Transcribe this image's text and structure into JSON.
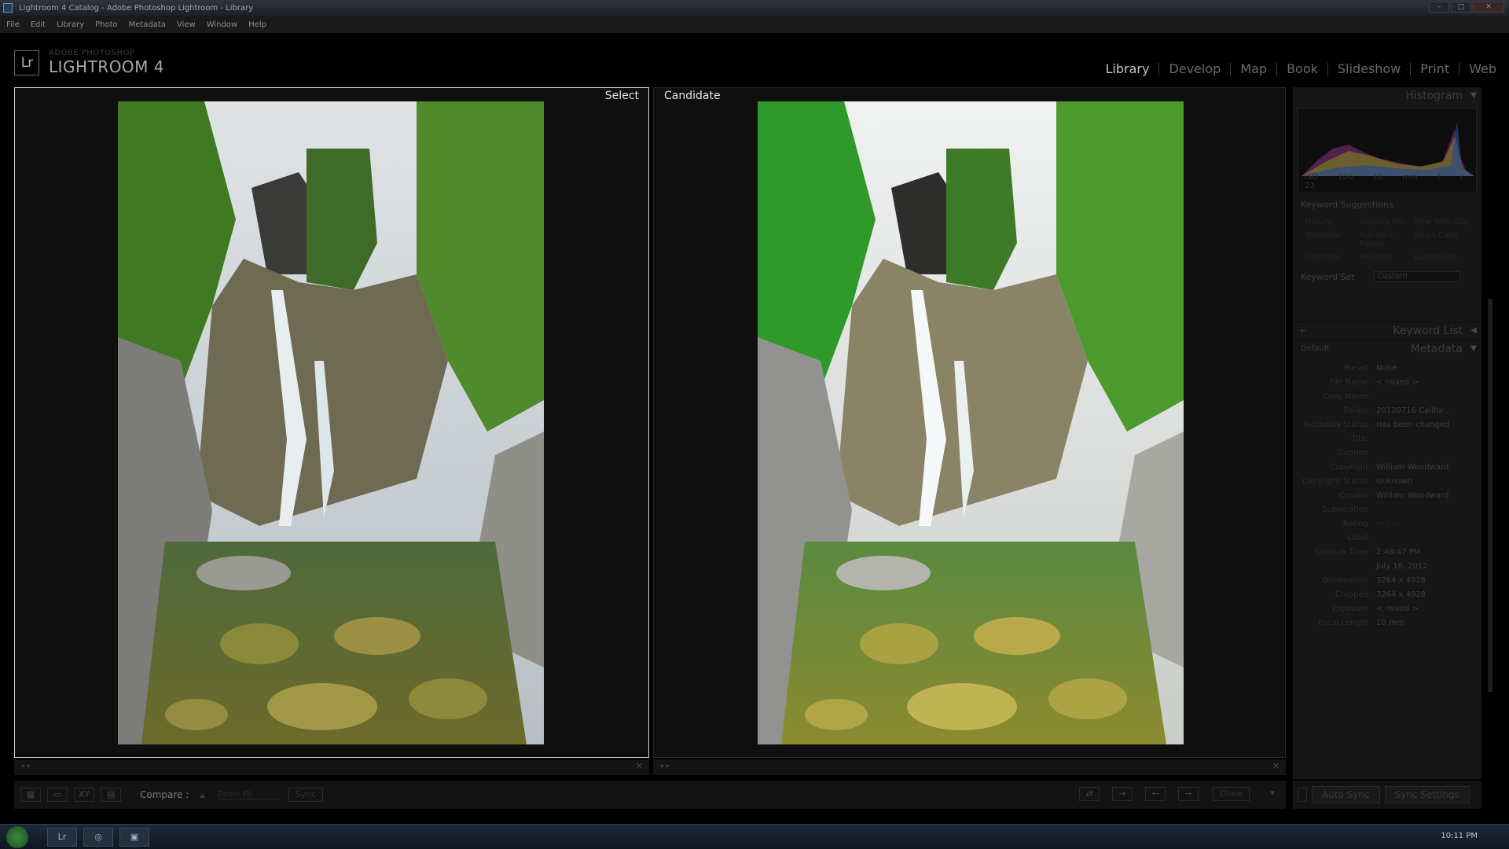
{
  "window": {
    "title": "Lightroom 4 Catalog - Adobe Photoshop Lightroom - Library",
    "buttons": [
      "–",
      "□",
      "✕"
    ]
  },
  "menu": [
    "File",
    "Edit",
    "Library",
    "Photo",
    "Metadata",
    "View",
    "Window",
    "Help"
  ],
  "identity": {
    "logo": "Lr",
    "sub": "ADOBE PHOTOSHOP",
    "main": "LIGHTROOM 4"
  },
  "modules": [
    "Library",
    "Develop",
    "Map",
    "Book",
    "Slideshow",
    "Print",
    "Web"
  ],
  "compare": {
    "select_label": "Select",
    "candidate_label": "Candidate"
  },
  "right_panel": {
    "histogram_title": "Histogram",
    "histogram_info": "ISO 100 10 mm f / 22",
    "keyword_suggestions_title": "Keyword Suggestions",
    "suggestions": [
      "Nature",
      "Arizona Bri...",
      "New York City",
      "Yosemite",
      "National Forest",
      "Kings Cany...",
      "Colorado",
      "Houston",
      "Landscape"
    ],
    "keyword_set_label": "Keyword Set",
    "keyword_set_value": "Custom",
    "keyword_list_title": "Keyword List",
    "metadata_title": "Metadata",
    "metadata_preset_default": "Default",
    "metadata": [
      {
        "k": "Preset",
        "v": "None"
      },
      {
        "k": "File Name",
        "v": "< mixed >"
      },
      {
        "k": "Copy Name",
        "v": ""
      },
      {
        "k": "Folder",
        "v": "20120716 Califor..."
      },
      {
        "k": "Metadata Status",
        "v": "Has been changed"
      },
      {
        "k": "Title",
        "v": ""
      },
      {
        "k": "Caption",
        "v": ""
      },
      {
        "k": "Copyright",
        "v": "William Woodward"
      },
      {
        "k": "Copyright Status",
        "v": "Unknown"
      },
      {
        "k": "Creator",
        "v": "William Woodward"
      },
      {
        "k": "Sublocation",
        "v": ""
      },
      {
        "k": "Rating",
        "v": "· · · · ·"
      },
      {
        "k": "Label",
        "v": ""
      },
      {
        "k": "Capture Time",
        "v": "2:48:47 PM"
      },
      {
        "k": "",
        "v": "July 16, 2012"
      },
      {
        "k": "Dimensions",
        "v": "3264 x 4928"
      },
      {
        "k": "Cropped",
        "v": "3264 x 4928"
      },
      {
        "k": "Exposure",
        "v": "< mixed >"
      },
      {
        "k": "Focal Length",
        "v": "10 mm"
      }
    ]
  },
  "toolbar": {
    "compare_label": "Compare :",
    "zoom_label": "Zoom",
    "zoom_value": "Fit",
    "sync_label": "Sync",
    "done_label": "Done"
  },
  "sync_bar": {
    "auto_sync": "Auto Sync",
    "sync_settings": "Sync Settings"
  },
  "taskbar": {
    "time": "10:11 PM"
  }
}
